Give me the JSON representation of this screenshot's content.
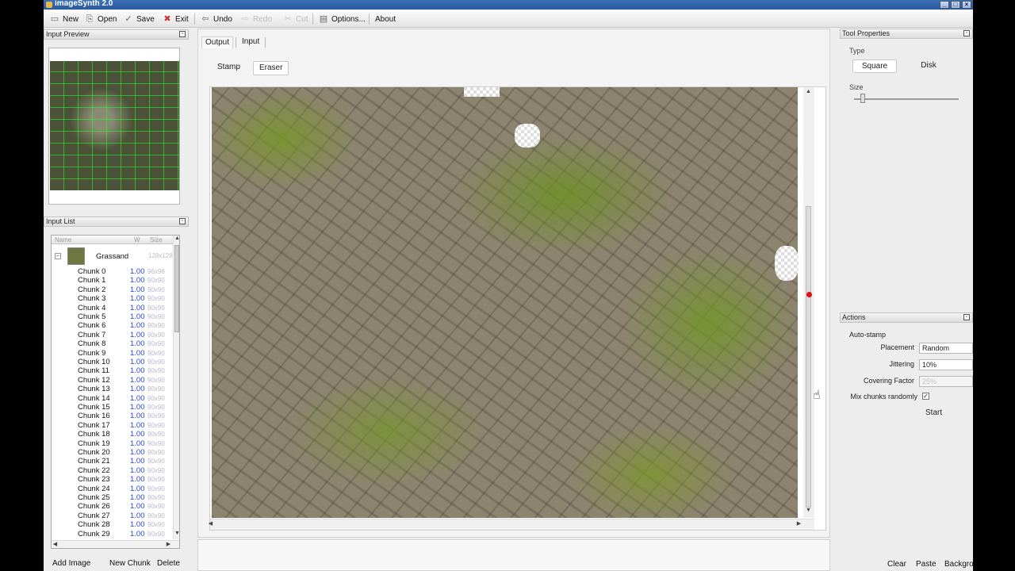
{
  "window": {
    "title": "imageSynth 2.0"
  },
  "toolbar": {
    "new": "New",
    "open": "Open",
    "save": "Save",
    "exit": "Exit",
    "undo": "Undo",
    "redo": "Redo",
    "cut": "Cut",
    "options": "Options...",
    "about": "About"
  },
  "input_preview": {
    "title": "Input Preview"
  },
  "input_list": {
    "title": "Input List",
    "columns": {
      "name": "Name",
      "weight": "W",
      "size": "Size"
    },
    "parent": {
      "name": "Grassand",
      "size": "128x128"
    },
    "chunks": [
      {
        "name": "Chunk 0",
        "weight": "1.00",
        "size": "96x96"
      },
      {
        "name": "Chunk 1",
        "weight": "1.00",
        "size": "90x90"
      },
      {
        "name": "Chunk 2",
        "weight": "1.00",
        "size": "90x90"
      },
      {
        "name": "Chunk 3",
        "weight": "1.00",
        "size": "90x90"
      },
      {
        "name": "Chunk 4",
        "weight": "1.00",
        "size": "90x90"
      },
      {
        "name": "Chunk 5",
        "weight": "1.00",
        "size": "90x90"
      },
      {
        "name": "Chunk 6",
        "weight": "1.00",
        "size": "90x90"
      },
      {
        "name": "Chunk 7",
        "weight": "1.00",
        "size": "90x90"
      },
      {
        "name": "Chunk 8",
        "weight": "1.00",
        "size": "90x90"
      },
      {
        "name": "Chunk 9",
        "weight": "1.00",
        "size": "90x90"
      },
      {
        "name": "Chunk 10",
        "weight": "1.00",
        "size": "90x90"
      },
      {
        "name": "Chunk 11",
        "weight": "1.00",
        "size": "90x90"
      },
      {
        "name": "Chunk 12",
        "weight": "1.00",
        "size": "90x90"
      },
      {
        "name": "Chunk 13",
        "weight": "1.00",
        "size": "90x90"
      },
      {
        "name": "Chunk 14",
        "weight": "1.00",
        "size": "90x90"
      },
      {
        "name": "Chunk 15",
        "weight": "1.00",
        "size": "90x90"
      },
      {
        "name": "Chunk 16",
        "weight": "1.00",
        "size": "90x90"
      },
      {
        "name": "Chunk 17",
        "weight": "1.00",
        "size": "90x90"
      },
      {
        "name": "Chunk 18",
        "weight": "1.00",
        "size": "90x90"
      },
      {
        "name": "Chunk 19",
        "weight": "1.00",
        "size": "90x90"
      },
      {
        "name": "Chunk 20",
        "weight": "1.00",
        "size": "90x90"
      },
      {
        "name": "Chunk 21",
        "weight": "1.00",
        "size": "90x90"
      },
      {
        "name": "Chunk 22",
        "weight": "1.00",
        "size": "90x90"
      },
      {
        "name": "Chunk 23",
        "weight": "1.00",
        "size": "90x90"
      },
      {
        "name": "Chunk 24",
        "weight": "1.00",
        "size": "90x90"
      },
      {
        "name": "Chunk 25",
        "weight": "1.00",
        "size": "90x90"
      },
      {
        "name": "Chunk 26",
        "weight": "1.00",
        "size": "90x90"
      },
      {
        "name": "Chunk 27",
        "weight": "1.00",
        "size": "90x90"
      },
      {
        "name": "Chunk 28",
        "weight": "1.00",
        "size": "90x90"
      },
      {
        "name": "Chunk 29",
        "weight": "1.00",
        "size": "90x90"
      }
    ]
  },
  "left_buttons": {
    "add_image": "Add Image",
    "new_chunk": "New Chunk",
    "delete": "Delete"
  },
  "center": {
    "tabs": [
      "Output",
      "Input"
    ],
    "tools": [
      "Stamp",
      "Eraser"
    ]
  },
  "tool_properties": {
    "title": "Tool Properties",
    "type_label": "Type",
    "type_options": [
      "Square",
      "Disk"
    ],
    "size_label": "Size"
  },
  "actions": {
    "title": "Actions",
    "auto_stamp": "Auto-stamp",
    "placement_label": "Placement",
    "placement_value": "Random",
    "jittering_label": "Jittering",
    "jittering_value": "10%",
    "covering_label": "Covering Factor",
    "covering_value": "25%",
    "mix_label": "Mix chunks randomly",
    "mix_checked": "✓",
    "start": "Start"
  },
  "right_buttons": {
    "clear": "Clear",
    "paste": "Paste",
    "background": "Background"
  },
  "colors": {
    "accent_green": "#28ff28",
    "weight_blue": "#2244cc",
    "marker_red": "#e01010"
  }
}
